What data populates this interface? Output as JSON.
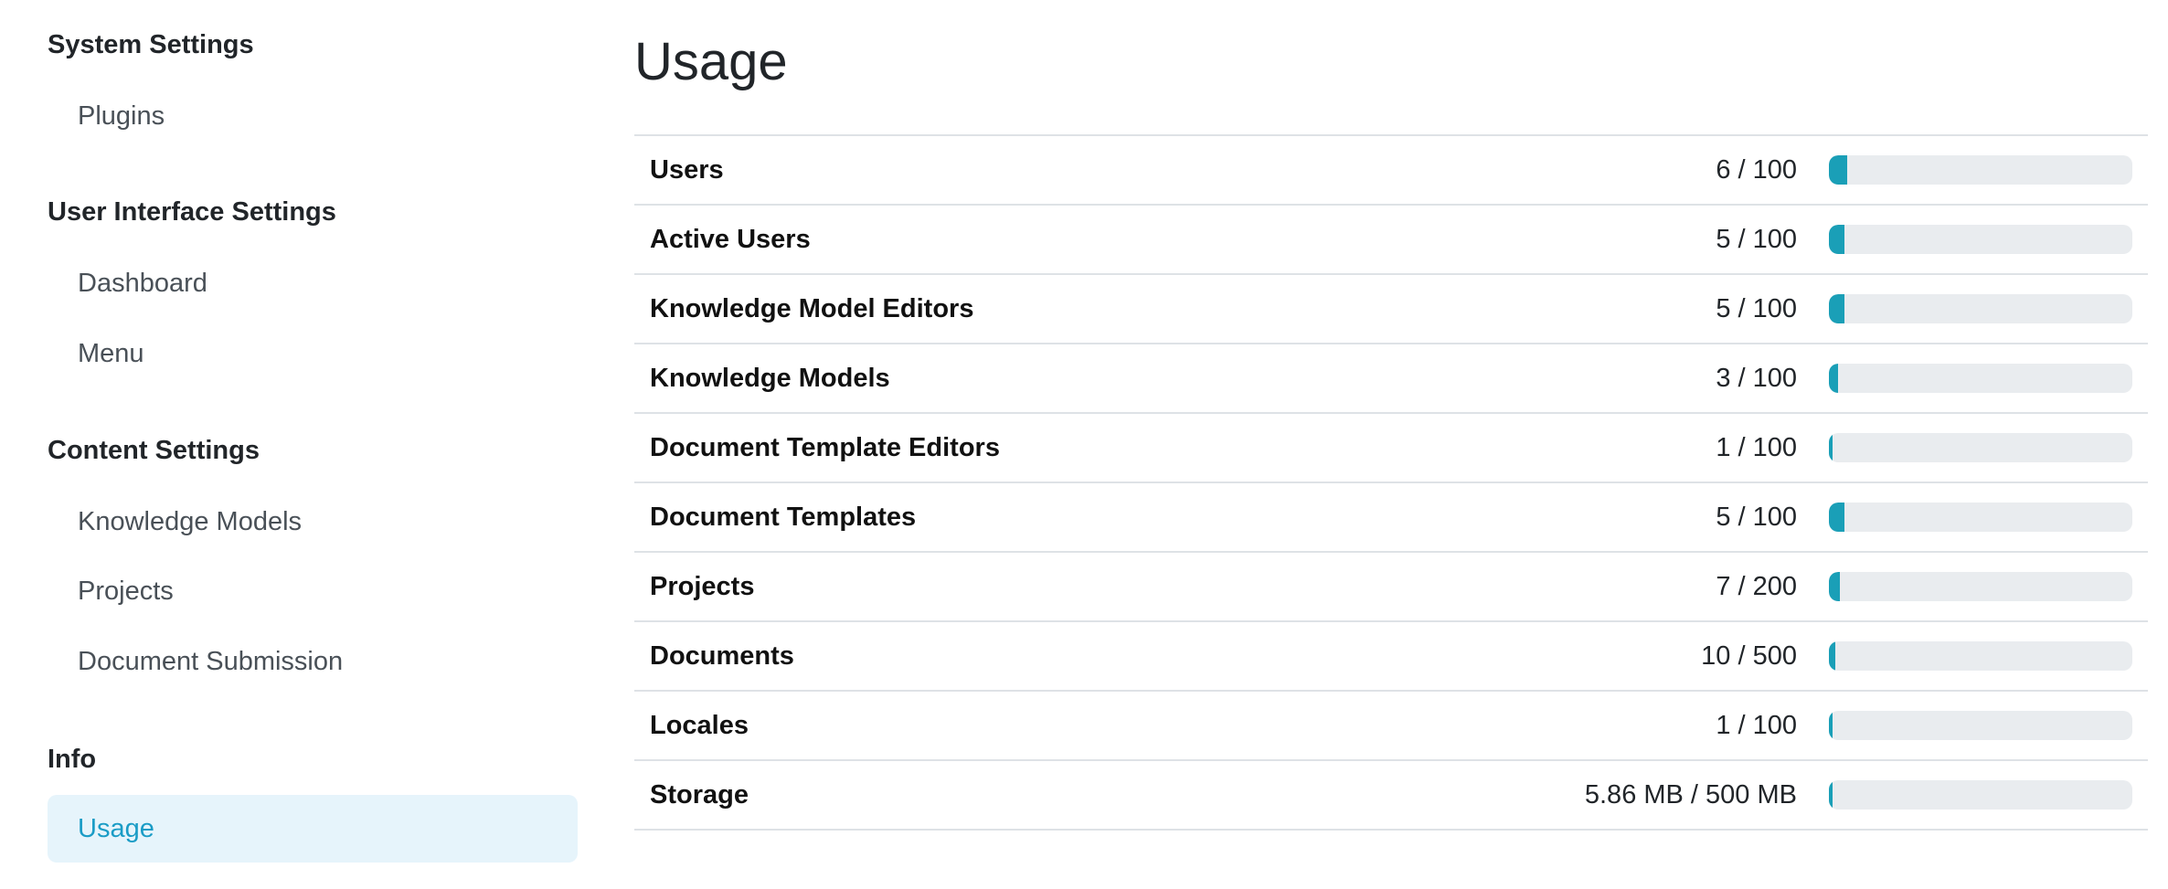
{
  "sidebar": {
    "groups": [
      {
        "title": "System Settings",
        "items": [
          {
            "label": "Plugins"
          }
        ]
      },
      {
        "title": "User Interface Settings",
        "items": [
          {
            "label": "Dashboard"
          },
          {
            "label": "Menu"
          }
        ]
      },
      {
        "title": "Content Settings",
        "items": [
          {
            "label": "Knowledge Models"
          },
          {
            "label": "Projects"
          },
          {
            "label": "Document Submission"
          }
        ]
      },
      {
        "title": "Info",
        "items": [
          {
            "label": "Usage",
            "active": true
          }
        ]
      }
    ]
  },
  "main": {
    "title": "Usage",
    "rows": [
      {
        "label": "Users",
        "value": "6 / 100",
        "fraction": 0.06
      },
      {
        "label": "Active Users",
        "value": "5 / 100",
        "fraction": 0.05
      },
      {
        "label": "Knowledge Model Editors",
        "value": "5 / 100",
        "fraction": 0.05
      },
      {
        "label": "Knowledge Models",
        "value": "3 / 100",
        "fraction": 0.03
      },
      {
        "label": "Document Template Editors",
        "value": "1 / 100",
        "fraction": 0.01
      },
      {
        "label": "Document Templates",
        "value": "5 / 100",
        "fraction": 0.05
      },
      {
        "label": "Projects",
        "value": "7 / 200",
        "fraction": 0.035
      },
      {
        "label": "Documents",
        "value": "10 / 500",
        "fraction": 0.02
      },
      {
        "label": "Locales",
        "value": "1 / 100",
        "fraction": 0.01
      },
      {
        "label": "Storage",
        "value": "5.86 MB / 500 MB",
        "fraction": 0.0117
      }
    ]
  },
  "colors": {
    "accent": "#1a9fb7",
    "active_bg": "#e6f4fb",
    "active_text": "#1a9cc6",
    "bar_track": "#e9ecef",
    "divider": "#dee2e6"
  }
}
